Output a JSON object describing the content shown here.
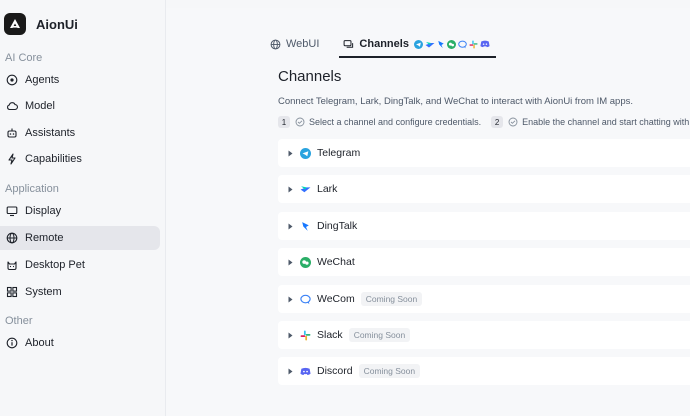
{
  "app": {
    "name": "AionUi"
  },
  "sidebar": {
    "sections": [
      {
        "label": "AI Core"
      },
      {
        "label": "Application"
      },
      {
        "label": "Other"
      }
    ],
    "items": [
      {
        "label": "Agents",
        "icon": "agents-icon"
      },
      {
        "label": "Model",
        "icon": "cloud-icon"
      },
      {
        "label": "Assistants",
        "icon": "robot-icon"
      },
      {
        "label": "Capabilities",
        "icon": "lightning-icon"
      },
      {
        "label": "Display",
        "icon": "monitor-icon"
      },
      {
        "label": "Remote",
        "icon": "globe-icon",
        "active": true
      },
      {
        "label": "Desktop Pet",
        "icon": "cat-icon"
      },
      {
        "label": "System",
        "icon": "grid-icon"
      },
      {
        "label": "About",
        "icon": "info-icon"
      }
    ]
  },
  "tabs": [
    {
      "label": "WebUI",
      "icon": "globe-icon"
    },
    {
      "label": "Channels",
      "icon": "chat-icon",
      "active": true
    }
  ],
  "page": {
    "title": "Channels",
    "description": "Connect Telegram, Lark, DingTalk, and WeChat to interact with AionUi from IM apps.",
    "steps": [
      {
        "num": "1",
        "text": "Select a channel and configure credentials."
      },
      {
        "num": "2",
        "text": "Enable the channel and start chatting with yo"
      }
    ]
  },
  "channels": [
    {
      "name": "Telegram",
      "badge": "",
      "icon": "telegram-icon",
      "color": "#2aa3df"
    },
    {
      "name": "Lark",
      "badge": "",
      "icon": "lark-icon",
      "color": "#3370ff"
    },
    {
      "name": "DingTalk",
      "badge": "",
      "icon": "dingtalk-icon",
      "color": "#1677ff"
    },
    {
      "name": "WeChat",
      "badge": "",
      "icon": "wechat-icon",
      "color": "#2aae67"
    },
    {
      "name": "WeCom",
      "badge": "Coming Soon",
      "icon": "wecom-icon",
      "color": "#3b82f6"
    },
    {
      "name": "Slack",
      "badge": "Coming Soon",
      "icon": "slack-icon",
      "color": "#e01e5a"
    },
    {
      "name": "Discord",
      "badge": "Coming Soon",
      "icon": "discord-icon",
      "color": "#5865f2"
    }
  ]
}
